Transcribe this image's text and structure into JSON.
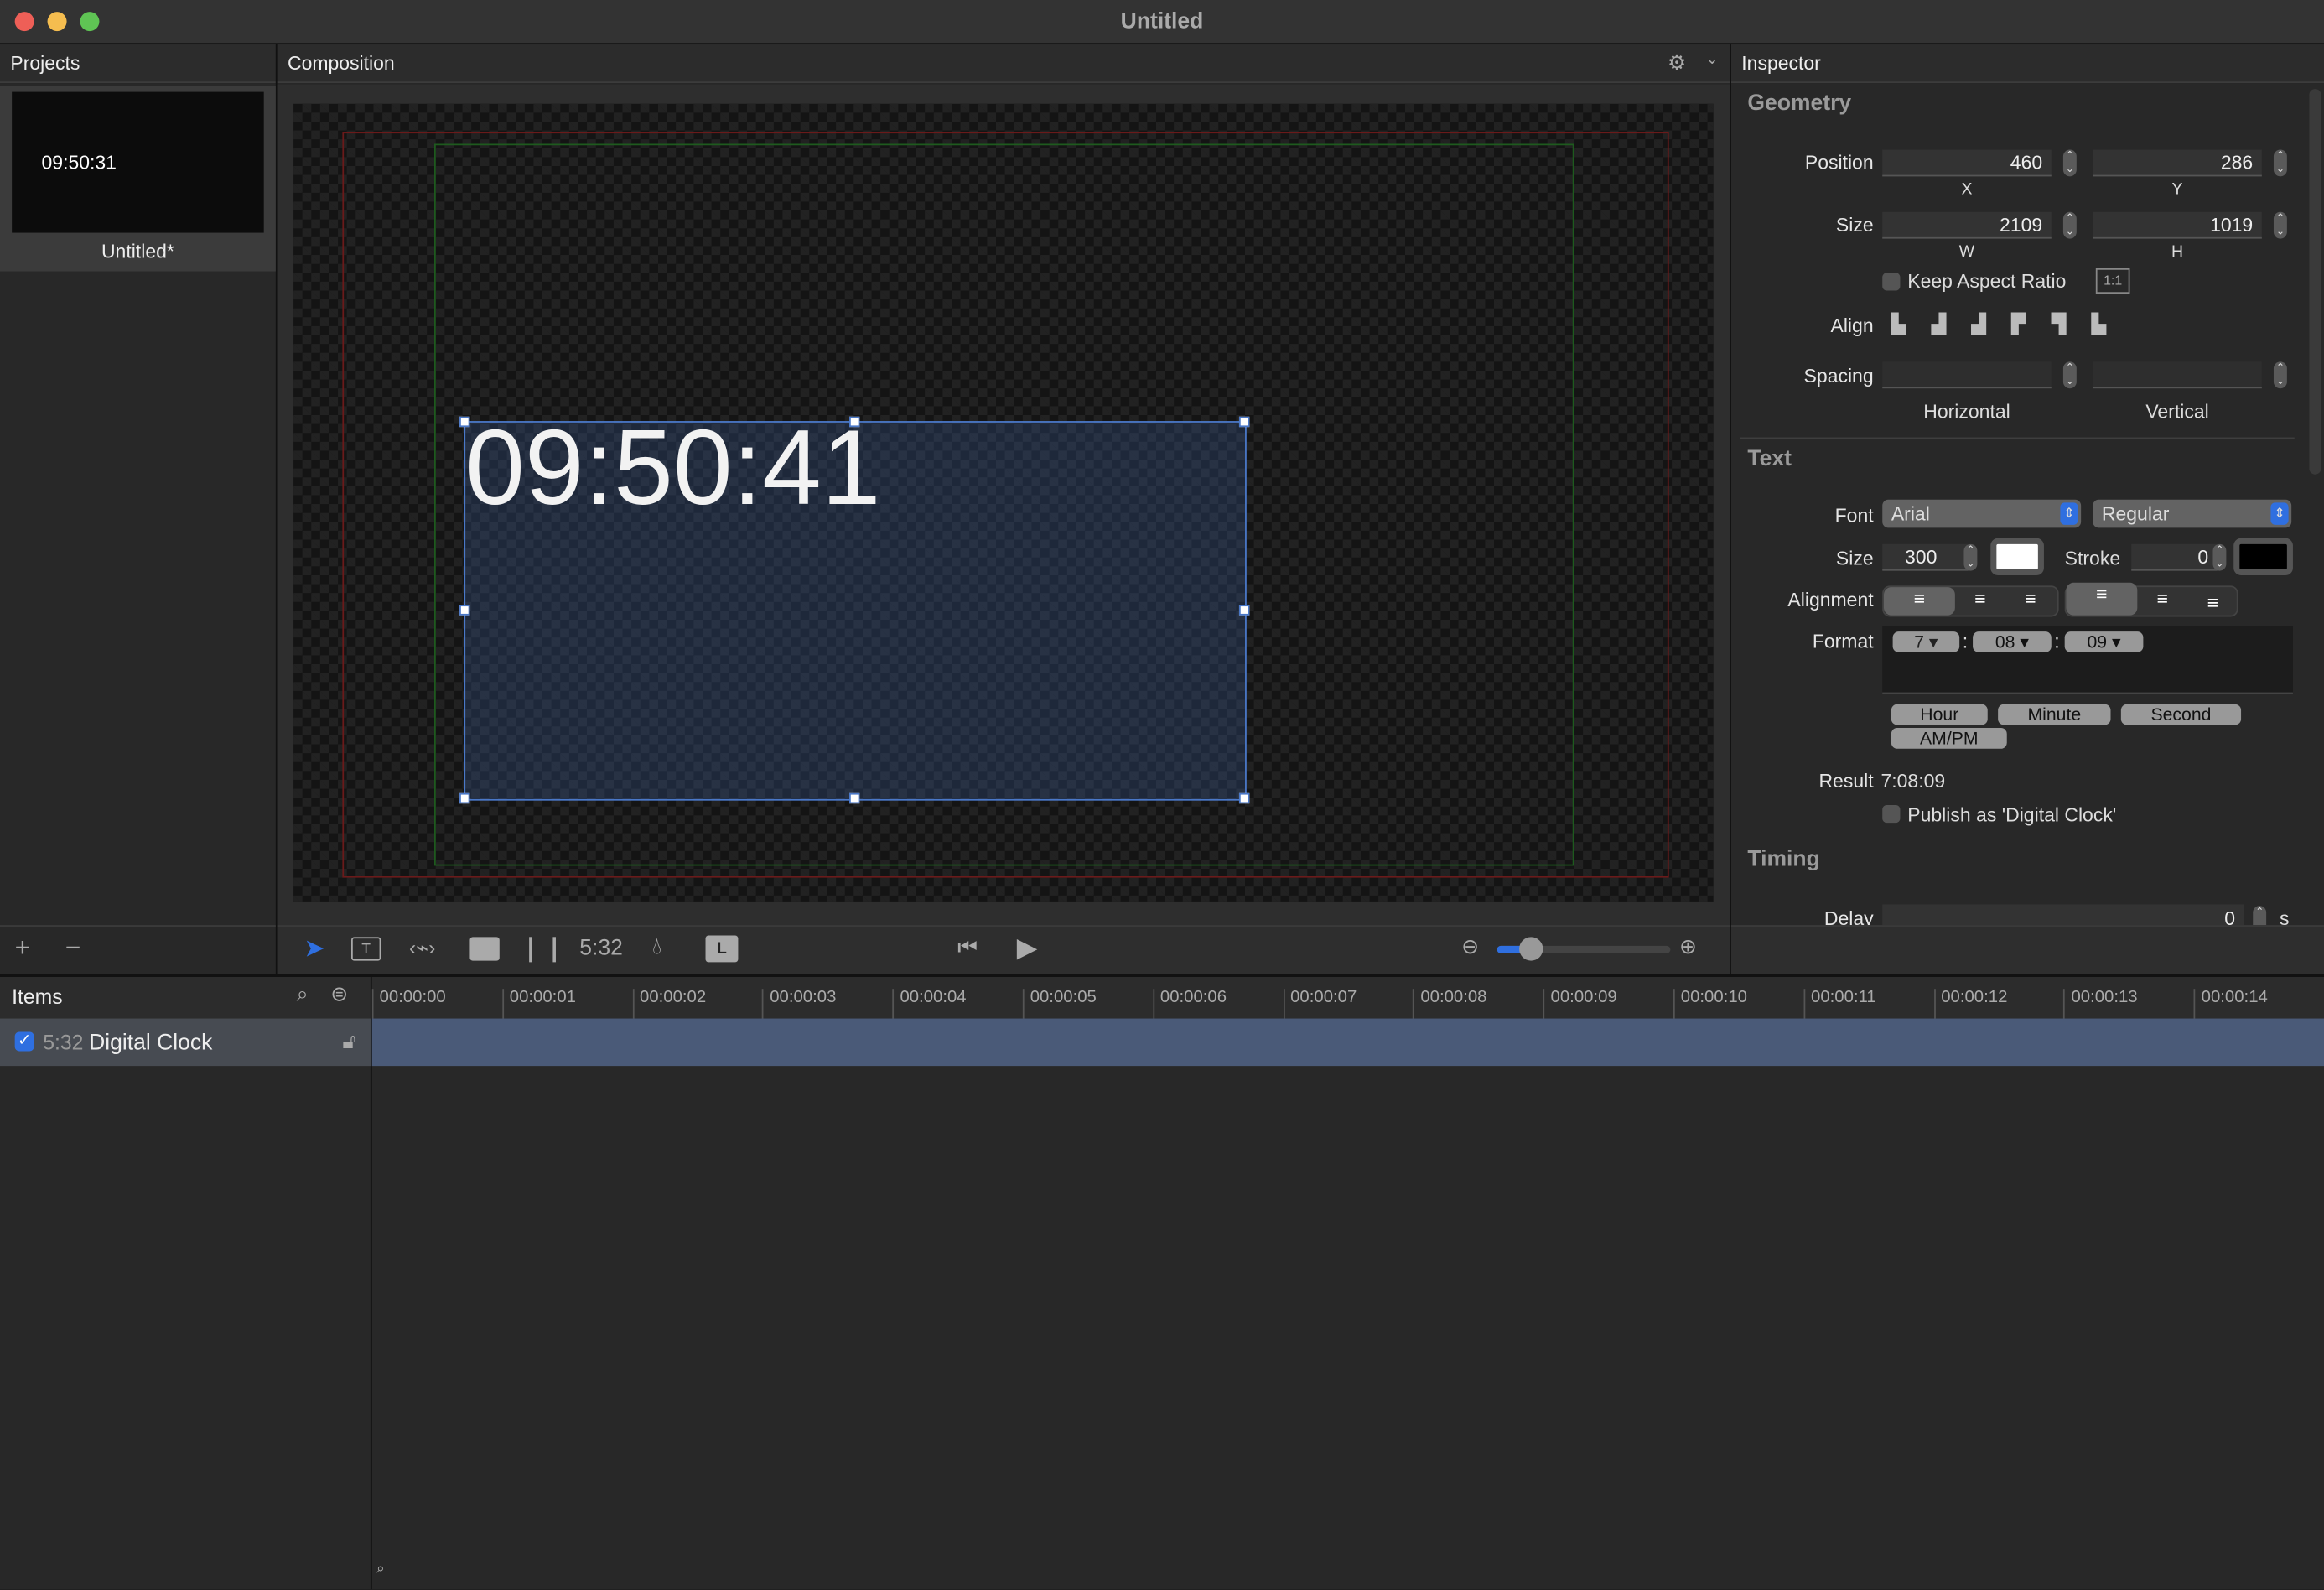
{
  "window": {
    "title": "Untitled"
  },
  "panels": {
    "projects": "Projects",
    "composition": "Composition",
    "inspector": "Inspector"
  },
  "projects": {
    "items": [
      {
        "thumbnail_text": "09:50:31",
        "label": "Untitled*"
      }
    ],
    "add": "+",
    "remove": "−"
  },
  "composition": {
    "clock_text": "09:50:41"
  },
  "inspector": {
    "geometry": {
      "title": "Geometry",
      "position_label": "Position",
      "x": "460",
      "y": "286",
      "x_label": "X",
      "y_label": "Y",
      "size_label": "Size",
      "w": "2109",
      "h": "1019",
      "w_label": "W",
      "h_label": "H",
      "keep_aspect": "Keep Aspect Ratio",
      "ratio_button": "1:1",
      "align_label": "Align",
      "spacing_label": "Spacing",
      "horizontal": "Horizontal",
      "vertical": "Vertical"
    },
    "text": {
      "title": "Text",
      "font_label": "Font",
      "font": "Arial",
      "style": "Regular",
      "size_label": "Size",
      "size": "300",
      "stroke_label": "Stroke",
      "stroke": "0",
      "text_color": "#ffffff",
      "stroke_color": "#000000",
      "alignment_label": "Alignment",
      "format_label": "Format",
      "format_tokens": [
        "7",
        "08",
        "09"
      ],
      "format_sep": ":",
      "token_buttons": [
        "Hour",
        "Minute",
        "Second",
        "AM/PM"
      ],
      "result_label": "Result",
      "result": "7:08:09",
      "publish": "Publish as 'Digital Clock'"
    },
    "timing": {
      "title": "Timing",
      "delay_label": "Delay",
      "delay": "0",
      "delay_unit": "s"
    }
  },
  "timeline": {
    "items_label": "Items",
    "rows": [
      {
        "checked": true,
        "icon_text": "5:32",
        "name": "Digital Clock"
      }
    ],
    "ticks": [
      "00:00:00",
      "00:00:01",
      "00:00:02",
      "00:00:03",
      "00:00:04",
      "00:00:05",
      "00:00:06",
      "00:00:07",
      "00:00:08",
      "00:00:09",
      "00:00:10",
      "00:00:11",
      "00:00:12",
      "00:00:13",
      "00:00:14"
    ]
  },
  "toolbar": {
    "clock_tool": "5:32",
    "zoom_level": 0.2
  },
  "colors": {
    "accent": "#2f6fe0",
    "clip": "#4a5a78",
    "selection": "#4a78c8"
  }
}
